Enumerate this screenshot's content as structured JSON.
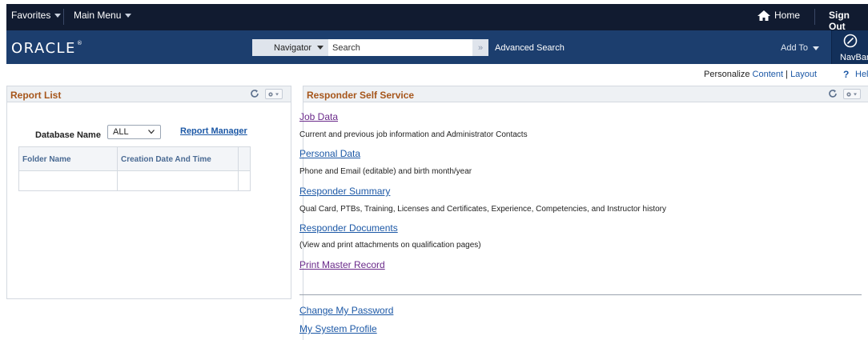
{
  "topbar": {
    "favorites": "Favorites",
    "main_menu": "Main Menu",
    "home": "Home",
    "sign_out": "Sign Out"
  },
  "brand": {
    "logo": "ORACLE",
    "trademark": "®",
    "navigator": "Navigator",
    "search_placeholder": "Search",
    "go": "»",
    "advanced_search": "Advanced Search",
    "add_to": "Add To",
    "navbar": "NavBar"
  },
  "personalize": {
    "label": "Personalize",
    "content": "Content",
    "separator": "|",
    "layout": "Layout",
    "help_icon": "?",
    "help": "Help"
  },
  "report_list": {
    "title": "Report List",
    "db_label": "Database Name",
    "db_value": "ALL",
    "report_manager": "Report Manager",
    "columns": [
      "Folder Name",
      "Creation Date And Time"
    ]
  },
  "responder": {
    "title": "Responder Self Service",
    "items": [
      {
        "label": "Job Data",
        "desc": "Current and previous job information and Administrator Contacts"
      },
      {
        "label": "Personal Data",
        "desc": "Phone and Email (editable) and birth month/year"
      },
      {
        "label": "Responder Summary",
        "desc": "Qual Card, PTBs, Training, Licenses and Certificates, Experience, Competencies, and Instructor history"
      },
      {
        "label": "Responder Documents",
        "desc": "(View and print attachments on qualification pages)"
      },
      {
        "label": "Print Master Record",
        "desc": ""
      }
    ],
    "extra_links": [
      "Change My Password",
      "My System Profile"
    ]
  },
  "colors": {
    "topbar": "#111b30",
    "brandbar": "#1c3e6e",
    "title_orange": "#a6561b",
    "link_blue": "#1c58a6",
    "visited_purple": "#6a2a8a"
  }
}
